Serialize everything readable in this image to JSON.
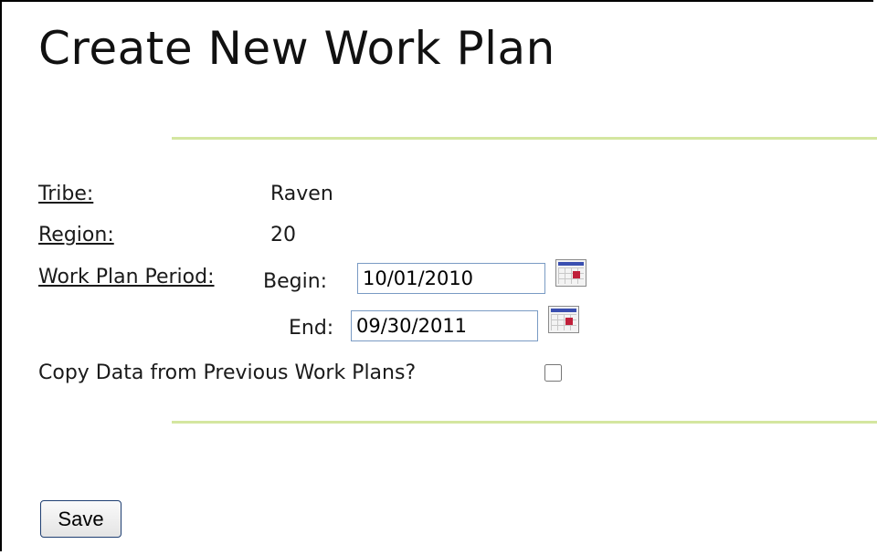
{
  "page": {
    "title": "Create New Work Plan"
  },
  "form": {
    "tribe": {
      "label": "Tribe:",
      "value": "Raven"
    },
    "region": {
      "label": "Region:",
      "value": "20"
    },
    "period": {
      "label": "Work Plan Period:",
      "begin_label": "Begin:",
      "begin_value": "10/01/2010",
      "end_label": "End:",
      "end_value": "09/30/2011"
    },
    "copy": {
      "label": "Copy Data from Previous Work Plans?",
      "checked": false
    },
    "save_label": "Save"
  },
  "colors": {
    "divider": "#d4e6a0",
    "input_border": "#7a9bc4",
    "calendar_mark": "#c0203a",
    "calendar_bar": "#3a4fb0"
  },
  "icons": {
    "date_picker": "calendar-icon"
  }
}
